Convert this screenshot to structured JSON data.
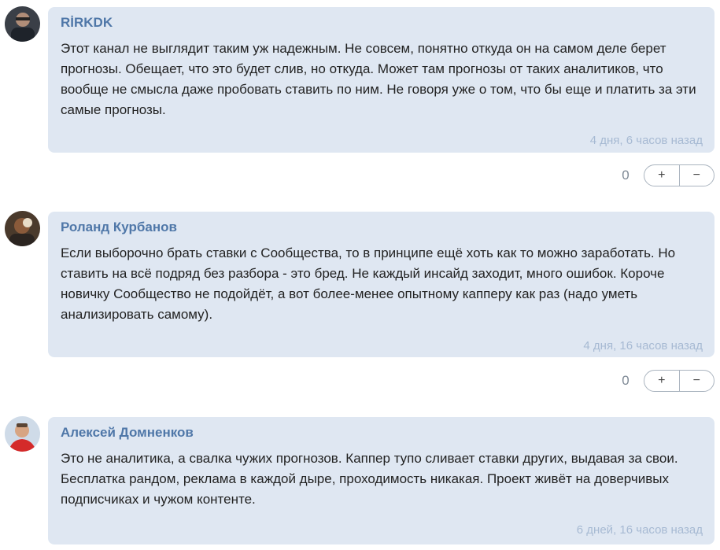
{
  "comments": [
    {
      "author": "RİRKDK",
      "text": "Этот канал не выглядит таким уж надежным. Не совсем, понятно откуда он на самом деле берет прогнозы. Обещает, что это будет слив, но откуда. Может там прогнозы от таких аналитиков, что вообще не смысла даже пробовать ставить по ним. Не говоря уже о том, что бы еще и платить за эти самые прогнозы.",
      "time": "4 дня, 6 часов назад",
      "votes": "0",
      "plus": "+",
      "minus": "−"
    },
    {
      "author": "Роланд Курбанов",
      "text": "Если выборочно брать ставки с Сообщества, то в принципе ещё хоть как то можно заработать. Но ставить на всё подряд без разбора - это бред. Не каждый инсайд заходит, много ошибок. Короче новичку Сообщество не подойдёт, а вот более-менее опытному капперу как раз (надо уметь анализировать самому).",
      "time": "4 дня, 16 часов назад",
      "votes": "0",
      "plus": "+",
      "minus": "−"
    },
    {
      "author": "Алексей Домненков",
      "text": "Это не аналитика, а свалка чужих прогнозов. Каппер тупо сливает ставки других, выдавая за свои. Бесплатка рандом, реклама в каждой дыре, проходимость никакая. Проект живёт на доверчивых подписчиках и чужом контенте.",
      "time": "6 дней, 16 часов назад"
    }
  ]
}
